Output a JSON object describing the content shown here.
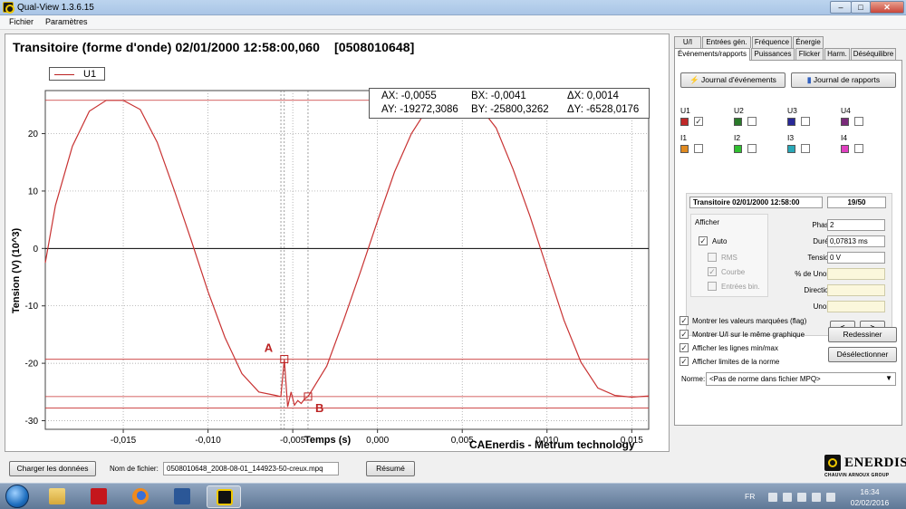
{
  "window": {
    "title": "Qual-View 1.3.6.15",
    "close_glyph": "✕",
    "min_glyph": "–",
    "max_glyph": "□"
  },
  "menu": {
    "items": [
      "Fichier",
      "Paramètres"
    ]
  },
  "plot": {
    "title": "Transitoire (forme d'onde) 02/01/2000 12:58:00,060",
    "id": "[0508010648]",
    "legend_label": "U1",
    "ylabel": "Tension (V) (10^3)",
    "xlabel": "Temps (s)",
    "brand": "CAEnerdis - Metrum technology",
    "measures": {
      "ax": "AX: -0,0055",
      "bx": "BX: -0,0041",
      "dx": "ΔX: 0,0014",
      "ay": "AY: -19272,3086",
      "by": "BY: -25800,3262",
      "dy": "ΔY: -6528,0176"
    },
    "marker_a": "A",
    "marker_b": "B"
  },
  "chart_data": {
    "type": "line",
    "title": "Transitoire (forme d'onde) 02/01/2000 12:58:00,060",
    "xlabel": "Temps (s)",
    "ylabel": "Tension (V) (10^3)",
    "xlim": [
      -0.0196,
      0.016
    ],
    "ylim": [
      -31.5,
      27.5
    ],
    "x_ticks": [
      "-0,015",
      "-0,010",
      "-0,005",
      "0,000",
      "0,005",
      "0,010",
      "0,015"
    ],
    "y_ticks": [
      "20",
      "10",
      "0",
      "-10",
      "-20",
      "-30"
    ],
    "series": [
      {
        "name": "U1",
        "color": "#c83232",
        "x": [
          -0.0196,
          -0.019,
          -0.018,
          -0.017,
          -0.016,
          -0.015,
          -0.014,
          -0.013,
          -0.012,
          -0.011,
          -0.01,
          -0.009,
          -0.008,
          -0.007,
          -0.006,
          -0.0057,
          -0.0055,
          -0.0053,
          -0.0051,
          -0.0049,
          -0.0047,
          -0.0045,
          -0.0043,
          -0.0041,
          -0.003,
          -0.002,
          -0.001,
          0.0,
          0.001,
          0.002,
          0.003,
          0.004,
          0.005,
          0.006,
          0.007,
          0.008,
          0.009,
          0.01,
          0.011,
          0.012,
          0.013,
          0.014,
          0.015,
          0.016
        ],
        "y": [
          -2.5,
          7.5,
          17.8,
          23.9,
          25.8,
          25.8,
          24.2,
          18.5,
          10.2,
          1.5,
          -7.5,
          -15.5,
          -21.8,
          -25.0,
          -25.6,
          -25.8,
          -19.3,
          -27.6,
          -25.0,
          -27.3,
          -26.5,
          -27.0,
          -26.2,
          -25.8,
          -20.5,
          -12.5,
          -4.0,
          4.8,
          13.3,
          20.0,
          24.6,
          25.8,
          25.8,
          24.8,
          21.0,
          13.8,
          5.6,
          -3.5,
          -12.5,
          -19.8,
          -24.3,
          -25.6,
          -25.9,
          -25.7
        ]
      }
    ],
    "cursor_lines_y": [
      25.8,
      -25.8,
      -27.8,
      -19.3
    ],
    "cursor_lines_x": [
      -0.0057,
      -0.0055,
      -0.0041
    ],
    "marker_a": {
      "x": -0.0055,
      "y": -19.27
    },
    "marker_b": {
      "x": -0.0041,
      "y": -25.8
    },
    "grid": true,
    "legend": "top-left"
  },
  "tabs": {
    "row1": [
      "U/I",
      "Entrées gén.",
      "Fréquence",
      "Énergie"
    ],
    "row2": [
      "Événements/rapports",
      "Puissances",
      "Flicker",
      "Harm.",
      "Déséquilibre"
    ]
  },
  "right": {
    "journal_btn": "Journal d'événements",
    "rapports_btn": "Journal de rapports",
    "channels": [
      {
        "label": "U1",
        "color": "#c02828",
        "checked": true
      },
      {
        "label": "U2",
        "color": "#2a7a2a",
        "checked": false
      },
      {
        "label": "U3",
        "color": "#282898",
        "checked": false
      },
      {
        "label": "U4",
        "color": "#7a2a7a",
        "checked": false
      },
      {
        "label": "I1",
        "color": "#e08a20",
        "checked": false
      },
      {
        "label": "I2",
        "color": "#30c030",
        "checked": false
      },
      {
        "label": "I3",
        "color": "#28a8b8",
        "checked": false
      },
      {
        "label": "I4",
        "color": "#e040c0",
        "checked": false
      }
    ],
    "event_header": "Transitoire 02/01/2000 12:58:00",
    "event_count": "19/50",
    "afficher": "Afficher",
    "opt_auto": "Auto",
    "opt_rms": "RMS",
    "opt_courbe": "Courbe",
    "opt_entrees": "Entrées bin.",
    "fields": {
      "phase_label": "Phase",
      "phase_value": "2",
      "duree_label": "Durée",
      "duree_value": "0,07813 ms",
      "tension_label": "Tension",
      "tension_value": "0 V",
      "unom_pct_label": "% de Unom",
      "unom_pct_value": "",
      "direction_label": "Direction",
      "direction_value": "",
      "unom_label": "Unom",
      "unom_value": ""
    },
    "prev_glyph": "<",
    "next_glyph": ">",
    "check1": "Montrer les valeurs marquées (flag)",
    "check2": "Montrer U/I sur le même graphique",
    "check3": "Afficher les lignes min/max",
    "check4": "Afficher limites de la norme",
    "redessiner": "Redessiner",
    "deselectionner": "Désélectionner",
    "norme_label": "Norme:",
    "norme_value": "<Pas de norme dans fichier MPQ>"
  },
  "bottom": {
    "load_btn": "Charger les données",
    "fname_label": "Nom de fichier:",
    "fname_value": "0508010648_2008-08-01_144923-50-creux.mpq",
    "resume_btn": "Résumé",
    "logo_text": "ENERDIS",
    "logo_sub": "CHAUVIN ARNOUX GROUP"
  },
  "taskbar": {
    "apps": [
      "explorer-folder",
      "pdf-reader",
      "firefox",
      "word",
      "qualview"
    ],
    "lang": "FR",
    "time": "16:34",
    "date": "02/02/2016"
  }
}
